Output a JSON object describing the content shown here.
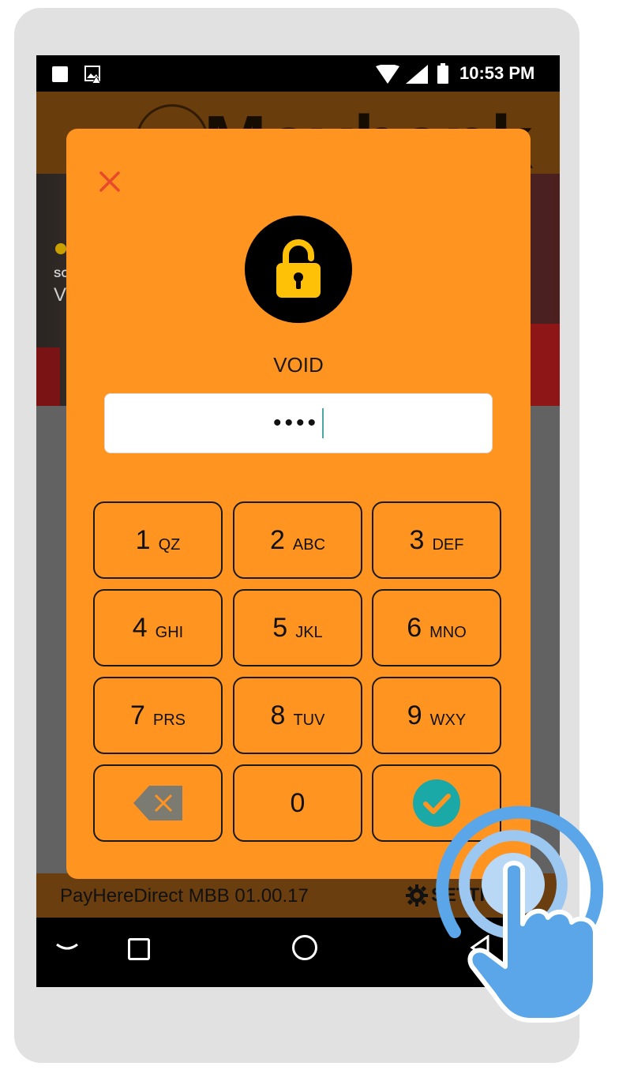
{
  "status_bar": {
    "time": "10:53 PM"
  },
  "app": {
    "brand": "Maybank",
    "banner_text_line1": "SO",
    "banner_text_line2": "V",
    "version": "PayHereDirect MBB 01.00.17",
    "settings_label": "SETTI"
  },
  "dialog": {
    "title": "VOID",
    "pin_value": "••••",
    "keys": [
      {
        "digit": "1",
        "letters": "QZ"
      },
      {
        "digit": "2",
        "letters": "ABC"
      },
      {
        "digit": "3",
        "letters": "DEF"
      },
      {
        "digit": "4",
        "letters": "GHI"
      },
      {
        "digit": "5",
        "letters": "JKL"
      },
      {
        "digit": "6",
        "letters": "MNO"
      },
      {
        "digit": "7",
        "letters": "PRS"
      },
      {
        "digit": "8",
        "letters": "TUV"
      },
      {
        "digit": "9",
        "letters": "WXY"
      },
      {
        "digit": "0",
        "letters": ""
      }
    ]
  },
  "colors": {
    "dialog_bg": "#ff9420",
    "accent_teal": "#1ba9a8",
    "close_red": "#e8492a",
    "lock_yellow": "#ffc107",
    "touch_blue": "#5aa6e8"
  },
  "icons": {
    "close": "close-icon",
    "lock": "lock-icon",
    "backspace": "backspace-icon",
    "confirm": "check-circle-icon"
  }
}
